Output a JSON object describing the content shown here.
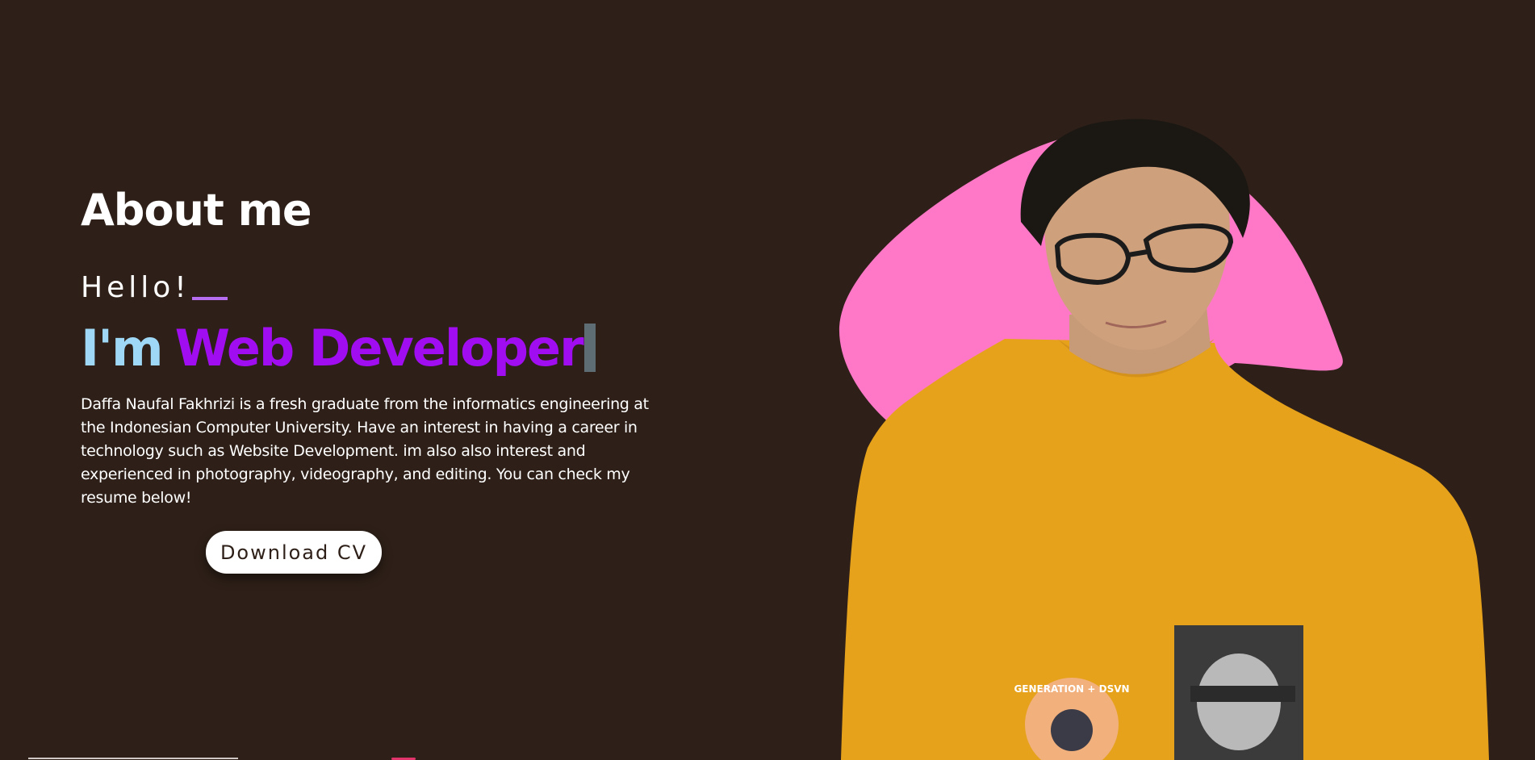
{
  "about": {
    "title": "About me",
    "greeting": "Hello!",
    "headline_prefix": "I'm",
    "headline_role": "Web Developer",
    "bio": "Daffa Naufal Fakhrizi is a fresh graduate from the informatics engineering at the Indonesian Computer University. Have an interest in having a career in technology such as Website Development. im also also interest and experienced in photography, videography, and editing. You can check my resume below!",
    "download_label": "Download CV"
  },
  "portrait": {
    "badge_text": "GENERATION + DSVN"
  },
  "colors": {
    "background": "#2e2018",
    "headline_prefix": "#9ed8f6",
    "headline_role": "#a00df0",
    "greeting_underline": "#b76df0",
    "blob": "#ff78c8",
    "sweater": "#e7a21c"
  }
}
